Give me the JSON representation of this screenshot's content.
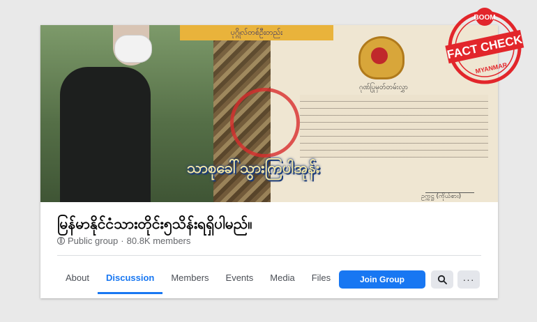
{
  "cover": {
    "top_caption": "ပုဂ္ဂိုလ်တစ်ဦးတည်း",
    "bottom_caption": "သာစုခေါ်သွားကြပါအုန်း",
    "certificate_heading": "ဂုဏ်ပြုမှတ်တမ်းလွှာ",
    "signature_label": "ဥက္ကဋ္ဌ (ကိုယ်စား)"
  },
  "group": {
    "title": "မြန်မာနိုင်ငံသားတိုင်း၅သိန်းရရှိပါမည်။",
    "privacy": "Public group",
    "separator": "·",
    "members": "80.8K members"
  },
  "tabs": [
    {
      "label": "About",
      "active": false
    },
    {
      "label": "Discussion",
      "active": true
    },
    {
      "label": "Members",
      "active": false
    },
    {
      "label": "Events",
      "active": false
    },
    {
      "label": "Media",
      "active": false
    },
    {
      "label": "Files",
      "active": false
    }
  ],
  "actions": {
    "join_label": "Join Group",
    "search_icon": "search-icon",
    "more_label": "···"
  },
  "badge": {
    "top": "BOOM",
    "main": "FACT CHECK",
    "bottom": "MYANMAR",
    "color": "#e2262b"
  },
  "colors": {
    "accent": "#1877f2"
  }
}
